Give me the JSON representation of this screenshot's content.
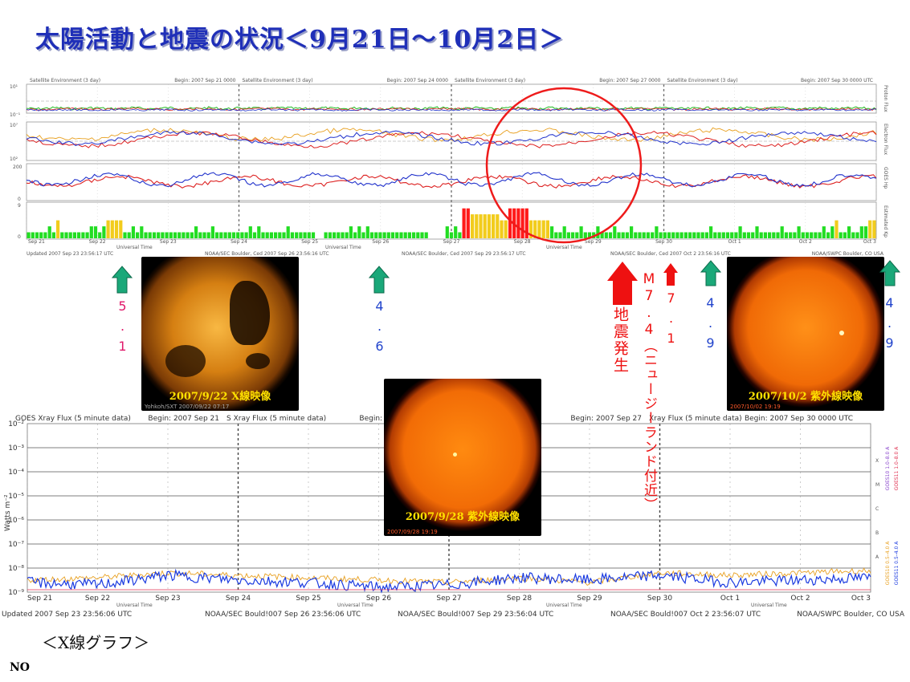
{
  "title": "太陽活動と地震の状況＜9月21日～10月2日＞",
  "top_panel": {
    "headers": [
      {
        "left": "Satellite Environment (3 day)",
        "right": "Begin:  2007 Sep 21 0000"
      },
      {
        "left": "Satellite Environment (3 day)",
        "right": "Begin:  2007 Sep 24 0000"
      },
      {
        "left": "Satellite Environment (3 day)",
        "right": "Begin:  2007 Sep 27 0000"
      },
      {
        "left": "Satellite Environment (3 day)",
        "right": "Begin:  2007 Sep 30 0000 UTC"
      }
    ],
    "row_labels": [
      "Proton Flux",
      "Electron Flux",
      "GOES Hp",
      "Estimated Kp"
    ],
    "y_labels": {
      "proton_top": "10¹",
      "proton_bottom": "10⁻¹",
      "electron_top": "10⁷",
      "electron_bottom": "10²",
      "hp_top": "200",
      "hp_bottom": "0",
      "kp_top": "9",
      "kp_bottom": "0"
    },
    "xaxis_label": "Universal Time",
    "footers": [
      "Updated 2007 Sep 23 23:56:17 UTC",
      "NOAA/SEC Boulder, Ced 2007 Sep 26 23:56:16 UTC",
      "NOAA/SEC Boulder, Ced 2007 Sep 29 23:56:17 UTC",
      "NOAA/SEC Boulder, Ced 2007 Oct  2 23:56:16 UTC",
      "NOAA/SWPC Boulder, CO USA"
    ]
  },
  "bottom_panel": {
    "headers": [
      {
        "left": "GOES Xray Flux (5 minute data)",
        "right": "Begin:  2007 Sep 21"
      },
      {
        "left": "S Xray Flux (5 minute data)",
        "right": "Begin:  2007 Sep 24"
      },
      {
        "left": "",
        "right": "Begin:  2007 Sep 27"
      },
      {
        "left": "Xray Flux (5 minute data)",
        "right": "Begin:  2007 Sep 30 0000 UTC"
      }
    ],
    "ylabel": "Watts m⁻²",
    "yticks": [
      "10⁻²",
      "10⁻³",
      "10⁻⁴",
      "10⁻⁵",
      "10⁻⁶",
      "10⁻⁷",
      "10⁻⁸",
      "10⁻⁹"
    ],
    "classes": [
      "X",
      "M",
      "C",
      "B",
      "A"
    ],
    "legend": [
      "GOES10 1.0–8.0 A",
      "GOES11 1.0–8.0 A",
      "GOES10 0.5–4.0 A",
      "GOES11 0.5–4.0 A"
    ],
    "xaxis_label": "Universal Time",
    "footers": [
      "Updated 2007 Sep 23 23:56:06 UTC",
      "NOAA/SEC Bould!007 Sep 26 23:56:06 UTC",
      "NOAA/SEC Bould!007 Sep 29 23:56:04 UTC",
      "NOAA/SEC Bould!007 Oct  2 23:56:07 UTC",
      "NOAA/SWPC Boulder, CO USA"
    ]
  },
  "annotations": {
    "quake1_mag": "5.1",
    "quake2_mag": "4.6",
    "quake3_mag": "4.9",
    "quake4_mag": "4.9",
    "quake_big": "地震発生",
    "quake_big_detail": "M7.4（ニュージーランド付近）",
    "quake_71": "7.1"
  },
  "images": {
    "sun1_caption": "2007/9/22 X線映像",
    "sun1_stamp": "Yohkoh/SXT  2007/09/22 07:17",
    "sun2_caption": "2007/9/28 紫外線映像",
    "sun2_stamp": "2007/09/28 19:19",
    "sun3_caption": "2007/10/2 紫外線映像",
    "sun3_stamp": "2007/10/02 19:19"
  },
  "xray_caption": "＜X線グラフ＞",
  "footer_note": "NO",
  "colors": {
    "title": "#1f2fb8",
    "arrow_green": "#1aa879",
    "arrow_red": "#ee1111",
    "kp_low": "#22dd22",
    "kp_mid": "#f2cc1c",
    "kp_high": "#ff1a1a",
    "magenta": "#e0186a",
    "blue": "#2244cc"
  },
  "chart_data": [
    {
      "type": "bar",
      "title": "Estimated Kp",
      "x": [
        "Sep 21",
        "Sep 22",
        "Sep 23",
        "Sep 24",
        "Sep 25",
        "Sep 26",
        "Sep 27",
        "Sep 28",
        "Sep 29",
        "Sep 30",
        "Oct 1",
        "Oct 2",
        "Oct 3"
      ],
      "values": [
        1,
        1,
        1,
        1,
        1,
        2,
        1,
        3,
        1,
        1,
        1,
        1,
        1,
        1,
        1,
        2,
        2,
        1,
        2,
        3,
        3,
        3,
        3,
        1,
        1,
        2,
        1,
        2,
        1,
        1,
        1,
        1,
        1,
        1,
        1,
        1,
        1,
        1,
        1,
        1,
        2,
        1,
        1,
        1,
        2,
        1,
        1,
        1,
        1,
        1,
        1,
        1,
        1,
        2,
        1,
        2,
        1,
        1,
        1,
        1,
        1,
        1,
        2,
        1,
        1,
        1,
        1,
        1,
        1,
        0,
        0,
        1,
        1,
        1,
        1,
        1,
        1,
        2,
        1,
        2,
        1,
        2,
        1,
        1,
        1,
        1,
        1,
        1,
        1,
        1,
        1,
        1,
        1,
        1,
        1,
        1,
        0,
        0,
        0,
        0,
        2,
        1,
        2,
        1,
        5,
        5,
        4,
        4,
        4,
        4,
        4,
        4,
        4,
        3,
        3,
        5,
        5,
        5,
        5,
        5,
        3,
        3,
        3,
        3,
        3,
        2,
        1,
        1,
        2,
        1,
        1,
        1,
        2,
        1,
        1,
        1,
        2,
        1,
        1,
        1,
        2,
        1,
        1,
        1,
        2,
        1,
        1,
        1,
        1,
        1,
        2,
        1,
        1,
        1,
        1,
        1,
        1,
        1,
        1,
        1,
        1,
        1,
        1,
        2,
        1,
        1,
        1,
        1,
        1,
        1,
        2,
        1,
        1,
        1,
        2,
        1,
        1,
        1,
        1,
        1,
        2,
        1,
        1,
        1,
        2,
        1,
        1,
        1,
        1,
        1,
        2,
        1,
        2,
        3,
        1,
        1,
        2,
        1,
        1,
        2,
        2,
        3,
        3
      ],
      "ylim": [
        0,
        9
      ]
    },
    {
      "type": "line",
      "title": "GOES Xray Flux (5 minute data)",
      "x": [
        "Sep 21",
        "Sep 22",
        "Sep 23",
        "Sep 24",
        "Sep 25",
        "Sep 26",
        "Sep 27",
        "Sep 28",
        "Sep 29",
        "Sep 30",
        "Oct 1",
        "Oct 2",
        "Oct 3"
      ],
      "series": [
        {
          "name": "GOES11 0.5–4.0 A",
          "values": [
            -8.6,
            -8.7,
            -8.3,
            -8.5,
            -8.6,
            -8.8,
            -8.7,
            -8.4,
            -8.5,
            -8.3,
            -8.6,
            -8.5,
            -8.4
          ]
        },
        {
          "name": "GOES10 0.5–4.0 A",
          "values": [
            -8.5,
            -8.4,
            -8.2,
            -8.3,
            -8.4,
            -8.5,
            -8.6,
            -8.4,
            -8.6,
            -8.2,
            -8.3,
            -8.2,
            -8.1
          ]
        }
      ],
      "ylabel": "Watts m⁻²",
      "ylim": [
        -9,
        -2
      ]
    }
  ]
}
